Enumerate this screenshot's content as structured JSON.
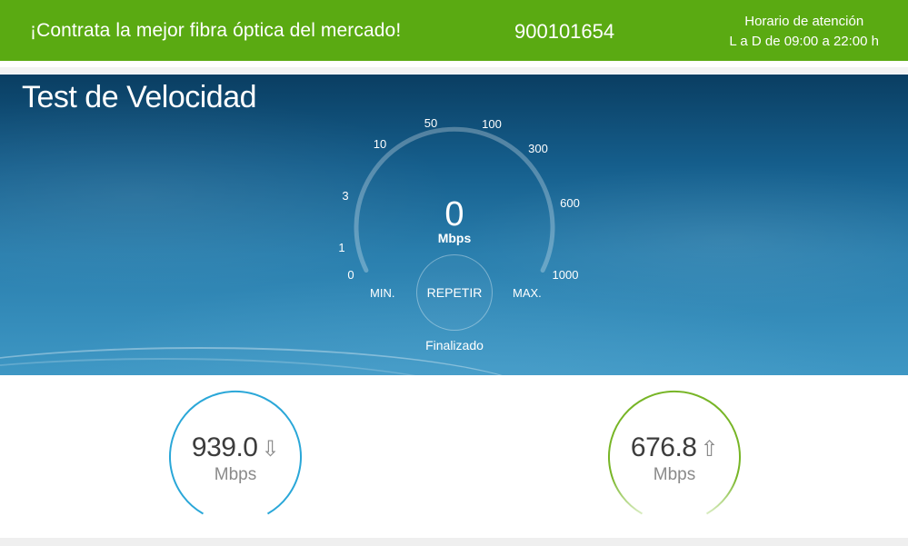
{
  "banner": {
    "promo": "¡Contrata la mejor fibra óptica del mercado!",
    "phone": "900101654",
    "hours_title": "Horario de atención",
    "hours_value": "L a D de 09:00 a 22:00 h",
    "color": "#5aaa12"
  },
  "speedtest": {
    "title": "Test de Velocidad",
    "gauge": {
      "ticks": [
        "0",
        "1",
        "3",
        "10",
        "50",
        "100",
        "300",
        "600",
        "1000"
      ],
      "value": "0",
      "unit": "Mbps",
      "min_label": "MIN.",
      "max_label": "MAX.",
      "level": 0
    },
    "repeat_label": "REPETIR",
    "status": "Finalizado"
  },
  "results": {
    "download": {
      "value": "939.0",
      "unit": "Mbps",
      "icon": "download-arrow-icon",
      "color": "#2aa7d8"
    },
    "upload": {
      "value": "676.8",
      "unit": "Mbps",
      "icon": "upload-arrow-icon",
      "color": "#77b526"
    }
  }
}
